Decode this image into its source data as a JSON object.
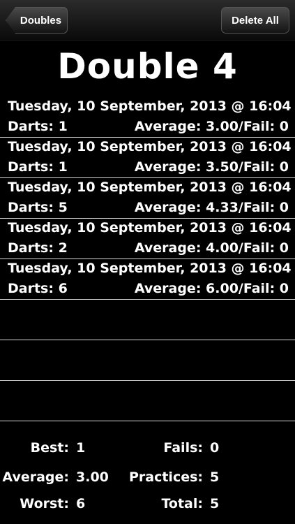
{
  "navbar": {
    "back_label": "Doubles",
    "delete_label": "Delete All"
  },
  "title": "Double 4",
  "rows": [
    {
      "date": "Tuesday, 10 September, 2013 @ 16:04",
      "darts": "Darts: 1",
      "average": "Average: 3.00/Fail: 0"
    },
    {
      "date": "Tuesday, 10 September, 2013 @ 16:04",
      "darts": "Darts: 1",
      "average": "Average: 3.50/Fail: 0"
    },
    {
      "date": "Tuesday, 10 September, 2013 @ 16:04",
      "darts": "Darts: 5",
      "average": "Average: 4.33/Fail: 0"
    },
    {
      "date": "Tuesday, 10 September, 2013 @ 16:04",
      "darts": "Darts: 2",
      "average": "Average: 4.00/Fail: 0"
    },
    {
      "date": "Tuesday, 10 September, 2013 @ 16:04",
      "darts": "Darts: 6",
      "average": "Average: 6.00/Fail: 0"
    }
  ],
  "stats": {
    "best_label": "Best:",
    "best_value": "1",
    "fails_label": "Fails:",
    "fails_value": "0",
    "average_label": "Average:",
    "average_value": "3.00",
    "practices_label": "Practices:",
    "practices_value": "5",
    "worst_label": "Worst:",
    "worst_value": "6",
    "total_label": "Total:",
    "total_value": "5"
  }
}
